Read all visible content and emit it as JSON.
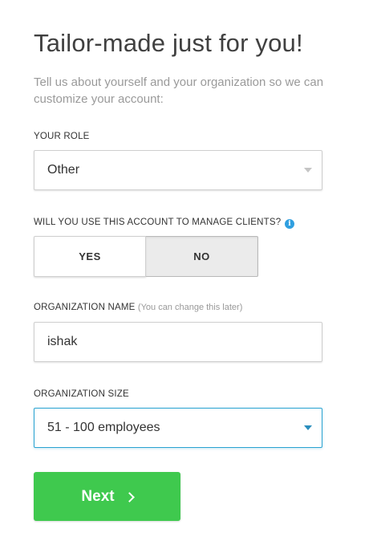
{
  "header": {
    "title": "Tailor-made just for you!",
    "subtitle": "Tell us about yourself and your organization so we can customize your account:"
  },
  "role": {
    "label": "YOUR ROLE",
    "value": "Other"
  },
  "manage_clients": {
    "label": "WILL YOU USE THIS ACCOUNT TO MANAGE CLIENTS?",
    "options": [
      "YES",
      "NO"
    ],
    "selected": "NO"
  },
  "org_name": {
    "label": "ORGANIZATION NAME",
    "hint": "(You can change this later)",
    "value": "ishak"
  },
  "org_size": {
    "label": "ORGANIZATION SIZE",
    "value": "51 - 100 employees"
  },
  "actions": {
    "next_label": "Next"
  },
  "icons": {
    "info": "info-icon",
    "next": "chevron-right-icon",
    "dropdown": "caret-down-icon"
  },
  "colors": {
    "primary_button": "#3fc94e",
    "focus_border": "#2aa3d1",
    "info": "#2f9fe0"
  }
}
